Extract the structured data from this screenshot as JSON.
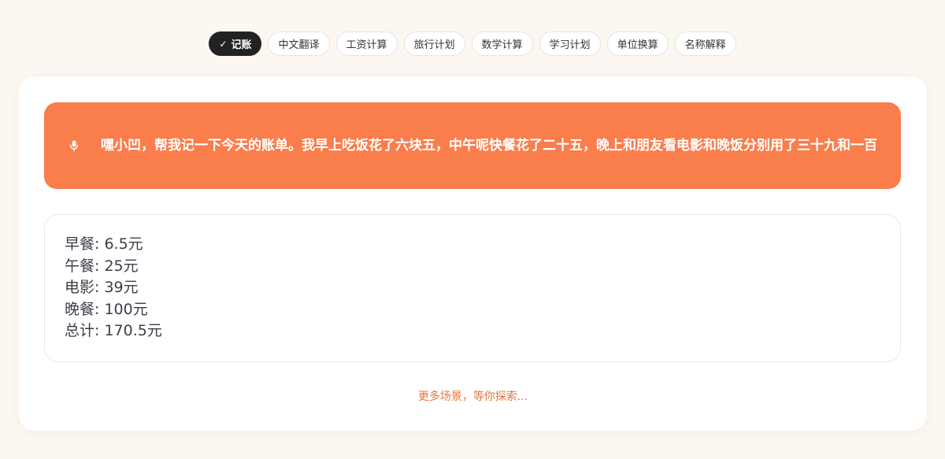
{
  "scenario_tabs": [
    {
      "label": "记账",
      "active": true
    },
    {
      "label": "中文翻译",
      "active": false
    },
    {
      "label": "工资计算",
      "active": false
    },
    {
      "label": "旅行计划",
      "active": false
    },
    {
      "label": "数学计算",
      "active": false
    },
    {
      "label": "学习计划",
      "active": false
    },
    {
      "label": "单位换算",
      "active": false
    },
    {
      "label": "名称解释",
      "active": false
    }
  ],
  "prompt": {
    "icon": "microphone-icon",
    "text": "嘿小凹，帮我记一下今天的账单。我早上吃饭花了六块五，中午呢快餐花了二十五，晚上和朋友看电影和晚饭分别用了三十九和一百"
  },
  "result": {
    "lines": [
      "早餐: 6.5元",
      "午餐: 25元",
      "电影: 39元",
      "晚餐: 100元",
      "总计: 170.5元"
    ]
  },
  "more_link": "更多场景，等你探索...",
  "colors": {
    "accent": "#fa7d4c",
    "active_tab_bg": "#222222",
    "link": "#e8743f",
    "page_bg": "#fdf7f2"
  }
}
